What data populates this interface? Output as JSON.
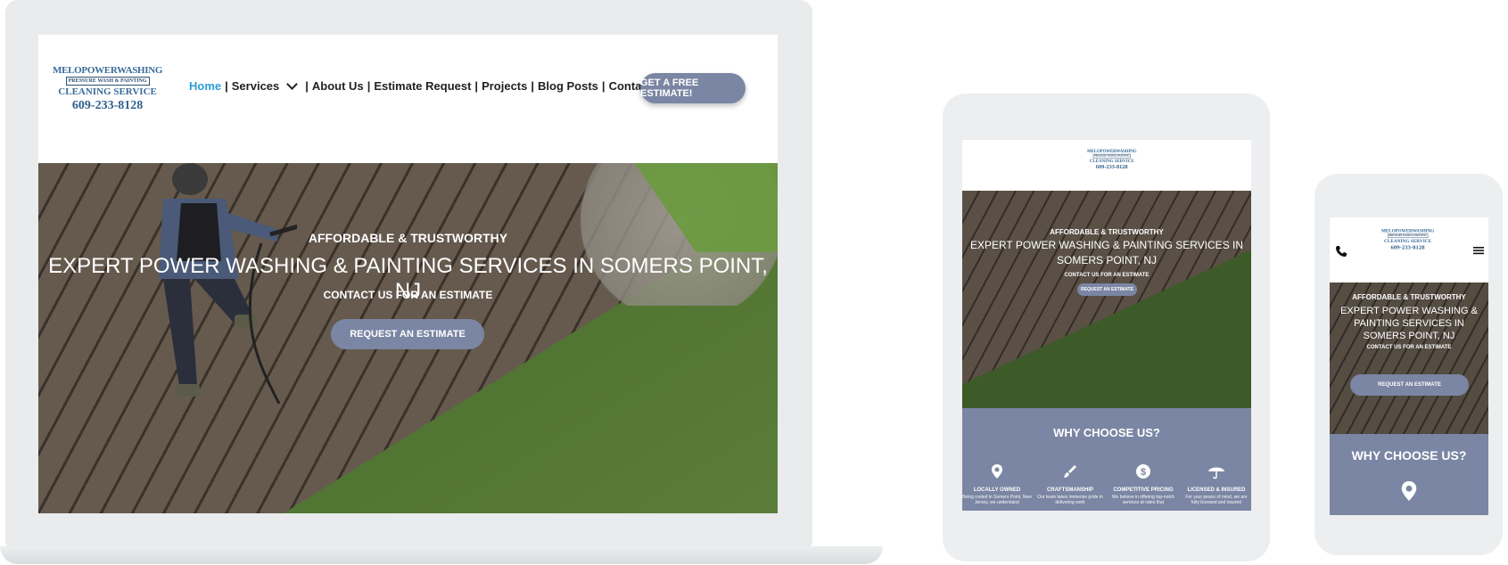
{
  "logo": {
    "line1": "MELOPOWERWASHING",
    "line2": "PRESSURE WASH & PAINTING",
    "line3": "CLEANING SERVICE",
    "phone": "609-233-8128"
  },
  "nav": {
    "items": [
      "Home",
      "Services",
      "About Us",
      "Estimate Request",
      "Projects",
      "Blog Posts",
      "Contact Us"
    ],
    "separator": "|"
  },
  "header_cta": "GET A FREE ESTIMATE!",
  "hero": {
    "eyebrow": "AFFORDABLE & TRUSTWORTHY",
    "headline": "EXPERT POWER WASHING & PAINTING SERVICES IN SOMERS POINT, NJ",
    "subhead": "CONTACT US FOR AN ESTIMATE",
    "button": "REQUEST AN ESTIMATE"
  },
  "why": {
    "title": "WHY CHOOSE US?",
    "features": [
      {
        "icon": "location-pin-icon",
        "title": "LOCALLY OWNED",
        "desc": "Being rooted in Somers Point, New Jersey, we understand"
      },
      {
        "icon": "paintbrush-icon",
        "title": "CRAFTSMANSHIP",
        "desc": "Our team takes immense pride in delivering work"
      },
      {
        "icon": "dollar-icon",
        "title": "COMPETITIVE PRICING",
        "desc": "We believe in offering top-notch services at rates that"
      },
      {
        "icon": "umbrella-icon",
        "title": "LICENSED & INSURED",
        "desc": "For your peace of mind, we are fully licensed and insured"
      }
    ]
  },
  "colors": {
    "accent": "#7a86a3",
    "nav_active": "#2a9fd6",
    "logo_blue": "#3a6b99"
  }
}
